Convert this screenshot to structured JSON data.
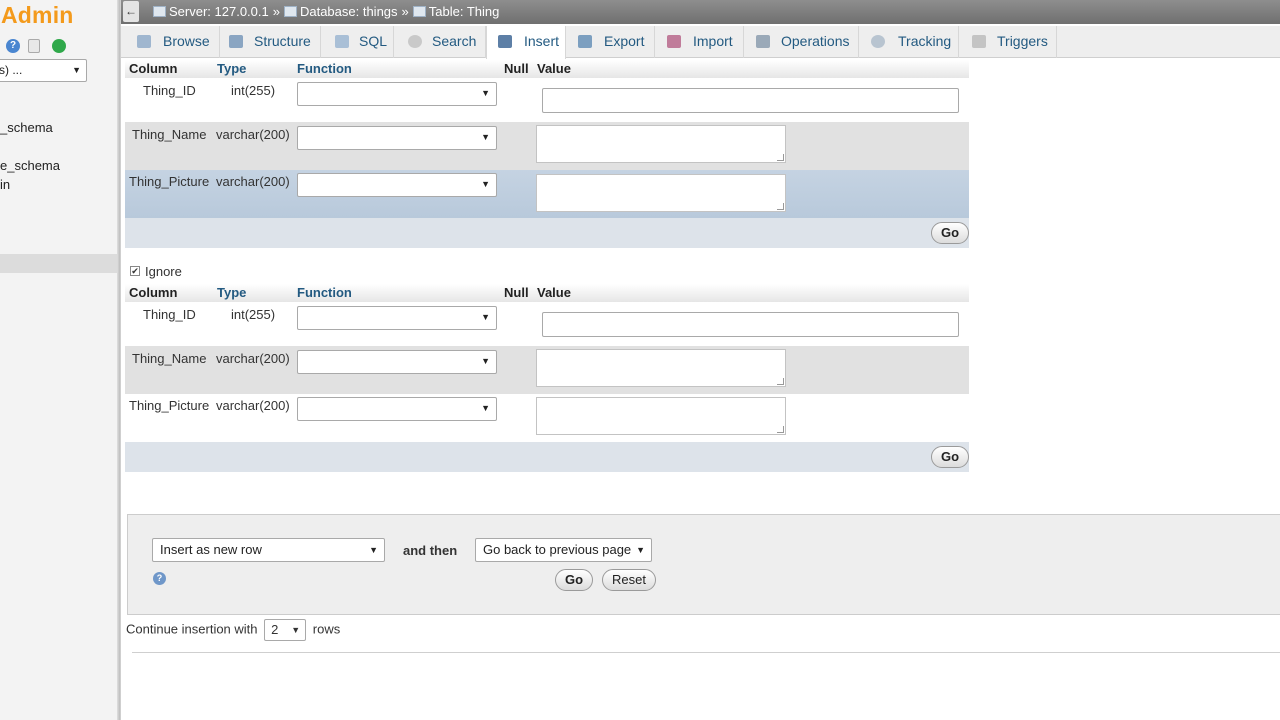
{
  "left_panel": {
    "logo_text": "Admin",
    "db_select_value": "s) ...",
    "databases": [
      "_schema",
      "",
      "e_schema",
      "in"
    ]
  },
  "breadcrumb": {
    "back_label": "←",
    "server": "Server: 127.0.0.1",
    "database": "Database: things",
    "table": "Table: Thing",
    "separator": "»"
  },
  "tabs": [
    {
      "label": "Browse",
      "icon": "browse-icon"
    },
    {
      "label": "Structure",
      "icon": "structure-icon"
    },
    {
      "label": "SQL",
      "icon": "sql-icon"
    },
    {
      "label": "Search",
      "icon": "search-icon"
    },
    {
      "label": "Insert",
      "icon": "insert-icon",
      "active": true
    },
    {
      "label": "Export",
      "icon": "export-icon"
    },
    {
      "label": "Import",
      "icon": "import-icon"
    },
    {
      "label": "Operations",
      "icon": "wrench-icon"
    },
    {
      "label": "Tracking",
      "icon": "eye-icon"
    },
    {
      "label": "Triggers",
      "icon": "triggers-icon"
    }
  ],
  "headers": {
    "column": "Column",
    "type": "Type",
    "function": "Function",
    "null": "Null",
    "value": "Value"
  },
  "form1": {
    "rows": [
      {
        "column": "Thing_ID",
        "type": "int(255)"
      },
      {
        "column": "Thing_Name",
        "type": "varchar(200)"
      },
      {
        "column": "Thing_Picture",
        "type": "varchar(200)"
      }
    ],
    "go_label": "Go"
  },
  "ignore": {
    "label": "Ignore",
    "checked": true,
    "check_glyph": "✔"
  },
  "form2": {
    "rows": [
      {
        "column": "Thing_ID",
        "type": "int(255)"
      },
      {
        "column": "Thing_Name",
        "type": "varchar(200)"
      },
      {
        "column": "Thing_Picture",
        "type": "varchar(200)"
      }
    ],
    "go_label": "Go"
  },
  "options": {
    "insert_mode": "Insert as new row",
    "and_then_label": "and then",
    "after_action": "Go back to previous page",
    "go_label": "Go",
    "reset_label": "Reset",
    "help_glyph": "?"
  },
  "continue": {
    "prefix": "Continue insertion with",
    "rows_value": "2",
    "suffix": "rows"
  },
  "glyphs": {
    "dropdown": "▼"
  },
  "colors": {
    "logo": "#f39a1c",
    "link": "#235a81",
    "go_bar": "#dde3ea",
    "highlight_row": "#c8d6e5"
  }
}
